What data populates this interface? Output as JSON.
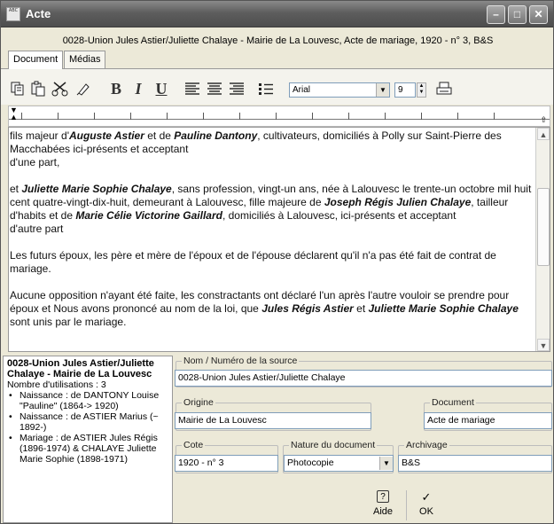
{
  "window": {
    "title": "Acte",
    "app_icon_text": "ABC",
    "controls": {
      "minimize": "–",
      "maximize": "□",
      "close": "✕"
    }
  },
  "record_title": "0028-Union Jules Astier/Juliette Chalaye - Mairie de La Louvesc, Acte de mariage, 1920 - n° 3, B&S",
  "tabs": [
    {
      "label": "Document",
      "active": true
    },
    {
      "label": "Médias",
      "active": false
    }
  ],
  "toolbar": {
    "icons": [
      "copy-icon",
      "paste-icon",
      "cut-icon",
      "eraser-icon",
      "bold-icon",
      "italic-icon",
      "underline-icon",
      "align-left-icon",
      "align-center-icon",
      "align-right-icon",
      "bullet-list-icon",
      "print-icon"
    ],
    "bold_label": "B",
    "italic_label": "I",
    "underline_label": "U",
    "font_value": "Arial",
    "size_value": "9"
  },
  "editor": {
    "paragraphs": [
      [
        {
          "t": "fils majeur d'"
        },
        {
          "t": "Auguste Astier",
          "bi": true
        },
        {
          "t": " et de "
        },
        {
          "t": "Pauline Dantony",
          "bi": true
        },
        {
          "t": ", cultivateurs, domiciliés à Polly sur Saint-Pierre des Macchabées ici-présents et acceptant"
        },
        {
          "br": true
        },
        {
          "t": "d'une part,"
        }
      ],
      [
        {
          "t": "et "
        },
        {
          "t": "Juliette Marie Sophie Chalaye",
          "bi": true
        },
        {
          "t": ", sans profession, vingt-un ans, née à Lalouvesc le trente-un octobre mil huit cent quatre-vingt-dix-huit, demeurant à Lalouvesc, fille majeure de "
        },
        {
          "t": "Joseph Régis Julien Chalaye",
          "bi": true
        },
        {
          "t": ", tailleur d'habits et de "
        },
        {
          "t": "Marie Célie Victorine Gaillard",
          "bi": true
        },
        {
          "t": ", domiciliés à Lalouvesc, ici-présents et acceptant"
        },
        {
          "br": true
        },
        {
          "t": "d'autre part"
        }
      ],
      [
        {
          "t": "Les futurs époux, les père et mère de l'époux et de l'épouse déclarent qu'il n'a pas été fait de contrat de mariage."
        }
      ],
      [
        {
          "t": "Aucune opposition n'ayant été faite, les constractants ont déclaré l'un après l'autre vouloir se prendre pour époux et Nous avons prononcé au nom de la loi, que "
        },
        {
          "t": "Jules Régis Astier",
          "bi": true
        },
        {
          "t": " et "
        },
        {
          "t": "Juliette Marie Sophie Chalaye",
          "bi": true
        },
        {
          "br": true
        },
        {
          "t": "sont unis par le mariage."
        }
      ]
    ]
  },
  "summary": {
    "title": "0028-Union Jules Astier/Juliette Chalaye - Mairie de La Louvesc",
    "count": "Nombre d'utilisations : 3",
    "items": [
      "Naissance :  de DANTONY Louise \"Pauline\" (1864-> 1920)",
      "Naissance :  de ASTIER Marius (~ 1892-)",
      "Mariage :  de ASTIER Jules Régis (1896-1974) & CHALAYE Juliette Marie Sophie (1898-1971)"
    ]
  },
  "fields": {
    "source_name": {
      "label": "Nom / Numéro de la source",
      "value": "0028-Union Jules Astier/Juliette Chalaye"
    },
    "origine": {
      "label": "Origine",
      "value": "Mairie de La Louvesc"
    },
    "document": {
      "label": "Document",
      "value": "Acte de mariage"
    },
    "cote": {
      "label": "Cote",
      "value": "1920 - n° 3"
    },
    "nature": {
      "label": "Nature du document",
      "value": "Photocopie"
    },
    "archivage": {
      "label": "Archivage",
      "value": "B&S"
    }
  },
  "buttons": {
    "help_label": "Aide",
    "help_icon_glyph": "?",
    "ok_label": "OK",
    "ok_icon_glyph": "✓"
  }
}
